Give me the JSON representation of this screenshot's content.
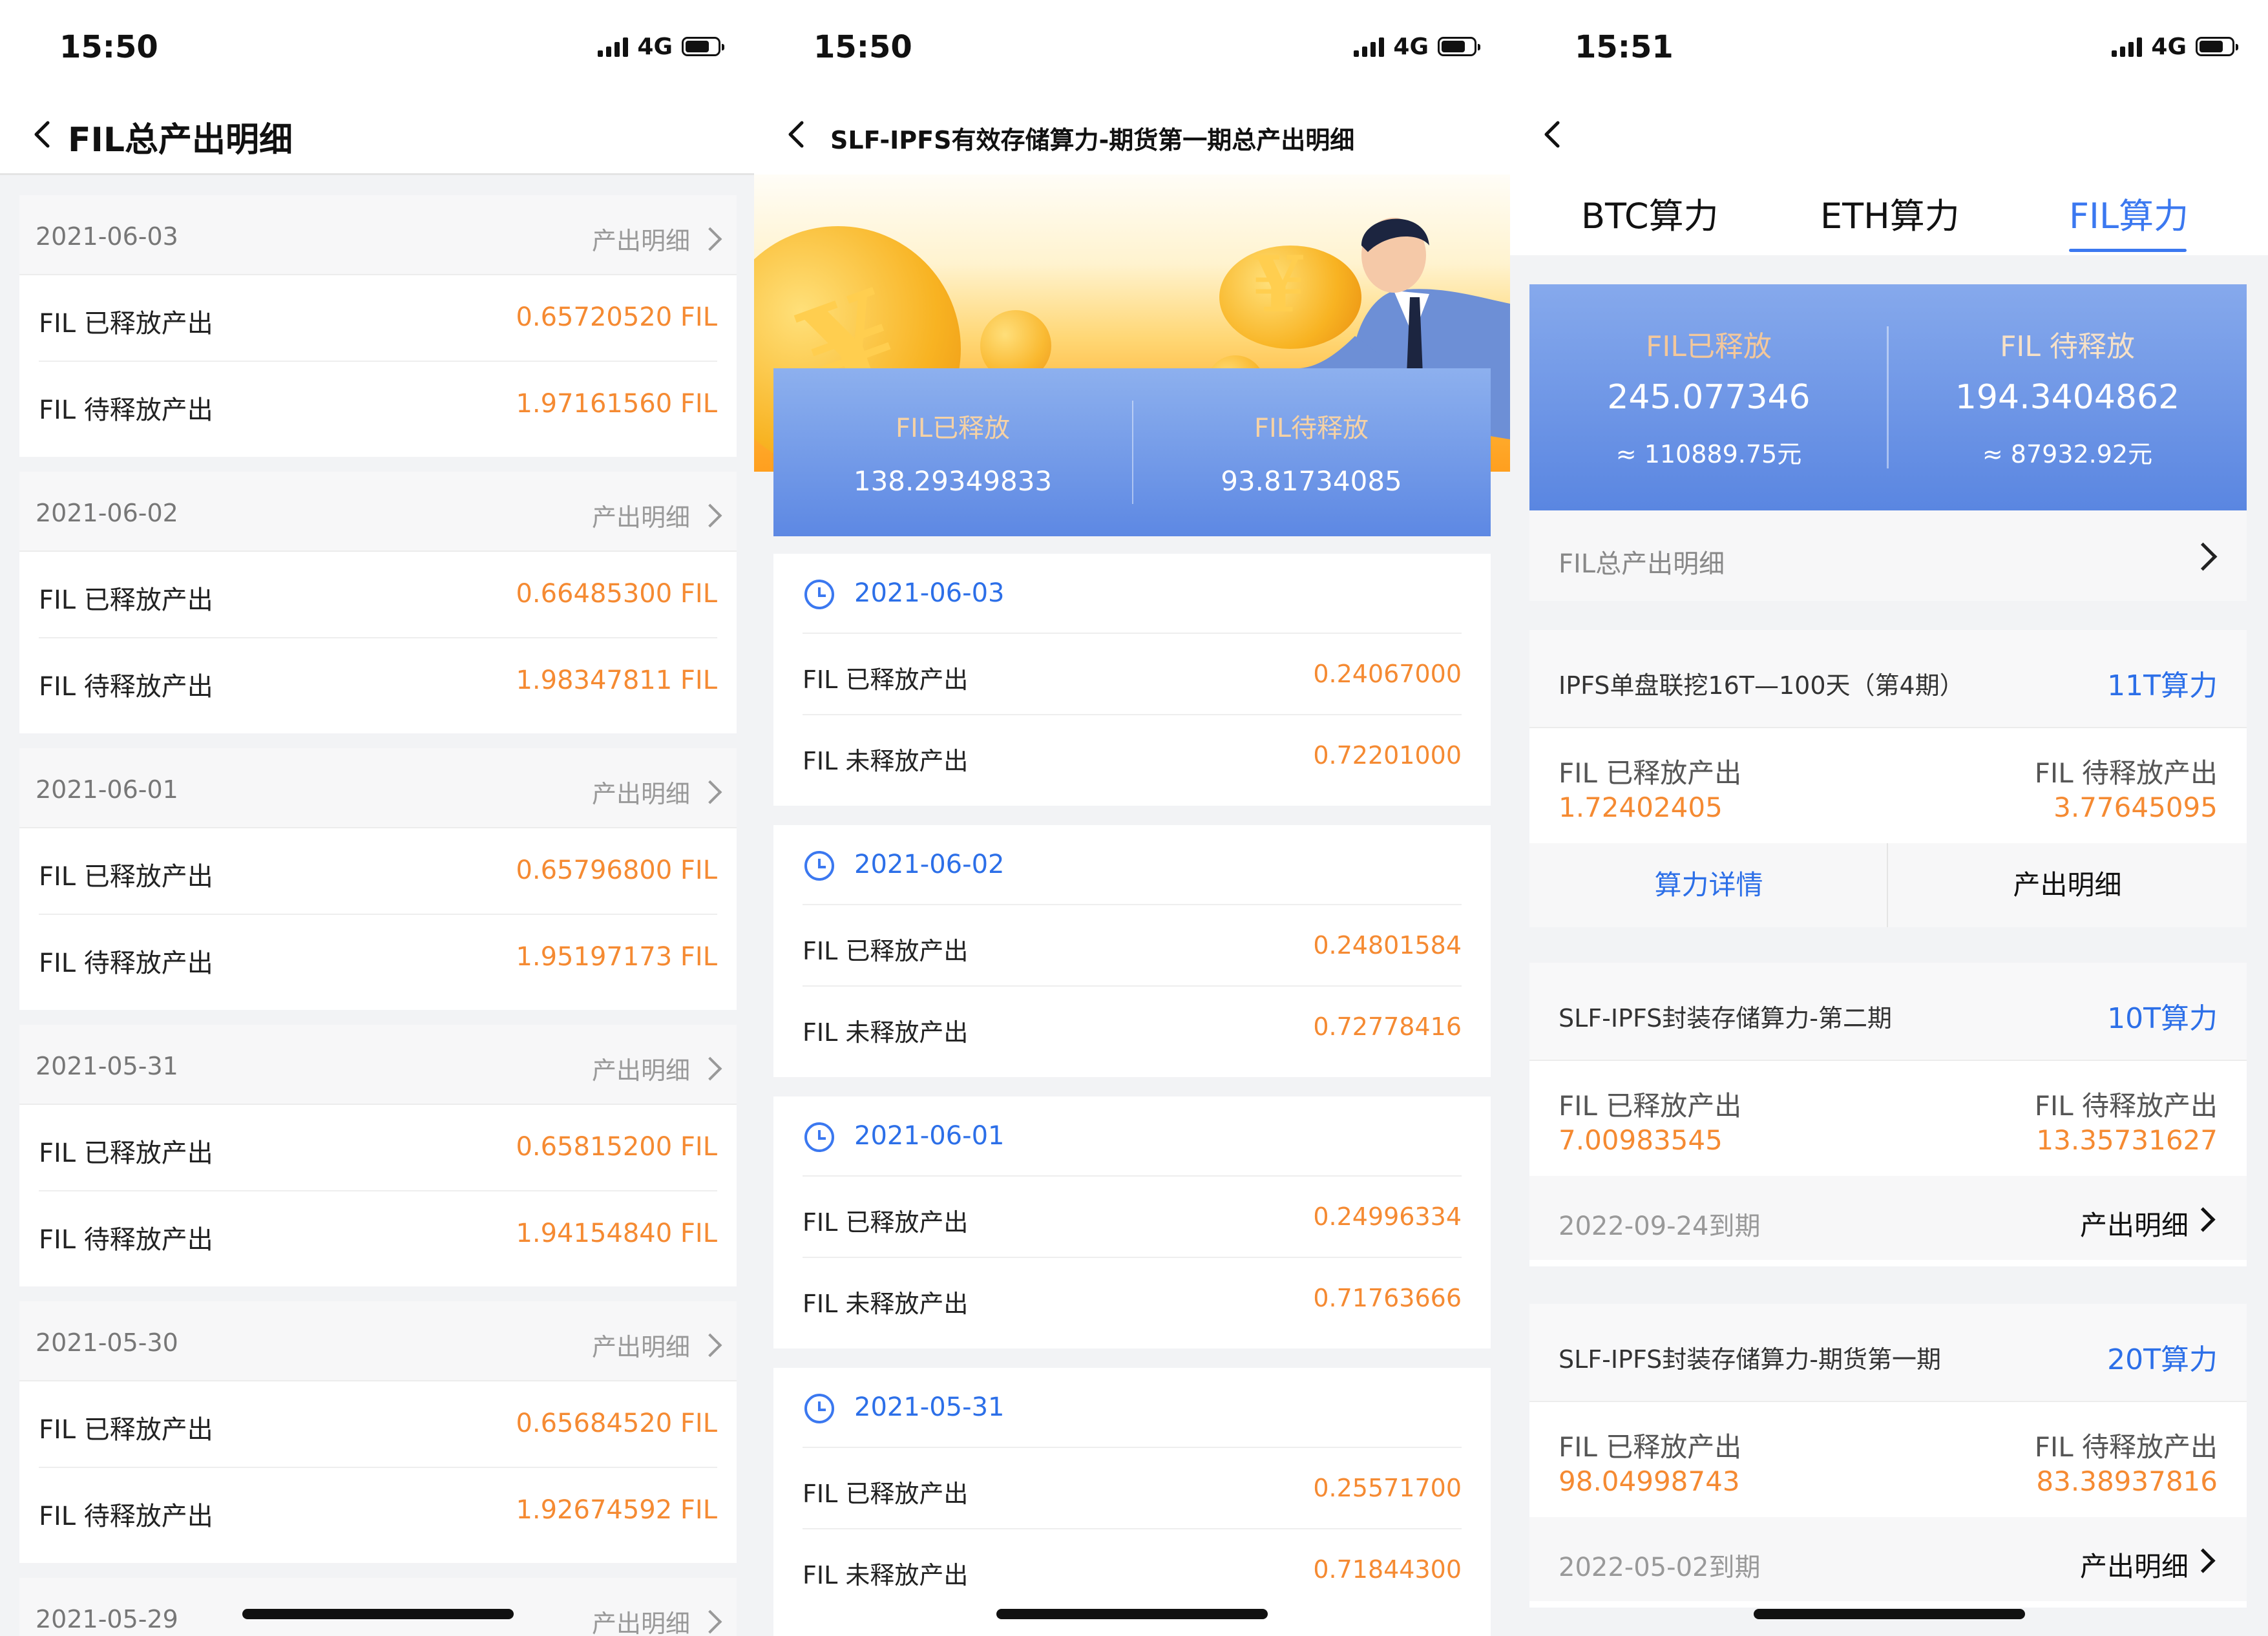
{
  "screens": [
    {
      "time": "15:50",
      "network": "4G",
      "title": "FIL总产出明细",
      "days": [
        {
          "date": "2021-06-03",
          "link": "产出明细",
          "released_label": "FIL 已释放产出",
          "released": "0.65720520 FIL",
          "pending_label": "FIL 待释放产出",
          "pending": "1.97161560 FIL"
        },
        {
          "date": "2021-06-02",
          "link": "产出明细",
          "released_label": "FIL 已释放产出",
          "released": "0.66485300 FIL",
          "pending_label": "FIL 待释放产出",
          "pending": "1.98347811 FIL"
        },
        {
          "date": "2021-06-01",
          "link": "产出明细",
          "released_label": "FIL 已释放产出",
          "released": "0.65796800 FIL",
          "pending_label": "FIL 待释放产出",
          "pending": "1.95197173 FIL"
        },
        {
          "date": "2021-05-31",
          "link": "产出明细",
          "released_label": "FIL 已释放产出",
          "released": "0.65815200 FIL",
          "pending_label": "FIL 待释放产出",
          "pending": "1.94154840 FIL"
        },
        {
          "date": "2021-05-30",
          "link": "产出明细",
          "released_label": "FIL 已释放产出",
          "released": "0.65684520 FIL",
          "pending_label": "FIL 待释放产出",
          "pending": "1.92674592 FIL"
        },
        {
          "date": "2021-05-29",
          "link": "产出明细"
        }
      ]
    },
    {
      "time": "15:50",
      "network": "4G",
      "title": "SLF-IPFS有效存储算力-期货第一期总产出明细",
      "summary": {
        "released_label": "FIL已释放",
        "released": "138.29349833",
        "pending_label": "FIL待释放",
        "pending": "93.81734085"
      },
      "days": [
        {
          "date": "2021-06-03",
          "released_label": "FIL 已释放产出",
          "released": "0.24067000",
          "pending_label": "FIL 未释放产出",
          "pending": "0.72201000"
        },
        {
          "date": "2021-06-02",
          "released_label": "FIL 已释放产出",
          "released": "0.24801584",
          "pending_label": "FIL 未释放产出",
          "pending": "0.72778416"
        },
        {
          "date": "2021-06-01",
          "released_label": "FIL 已释放产出",
          "released": "0.24996334",
          "pending_label": "FIL 未释放产出",
          "pending": "0.71763666"
        },
        {
          "date": "2021-05-31",
          "released_label": "FIL 已释放产出",
          "released": "0.25571700",
          "pending_label": "FIL 未释放产出",
          "pending": "0.71844300"
        }
      ]
    },
    {
      "time": "15:51",
      "network": "4G",
      "tabs": [
        "BTC算力",
        "ETH算力",
        "FIL算力"
      ],
      "active_tab": "FIL算力",
      "summary": {
        "released_label": "FIL已释放",
        "released": "245.077346",
        "released_cny": "≈ 110889.75元",
        "pending_label": "FIL 待释放",
        "pending": "194.3404862",
        "pending_cny": "≈ 87932.92元"
      },
      "total_link": "FIL总产出明细",
      "products": [
        {
          "name": "IPFS单盘联挖16T—100天（第4期）",
          "power": "11T算力",
          "released_label": "FIL 已释放产出",
          "released": "1.72402405",
          "pending_label": "FIL 待释放产出",
          "pending": "3.77645095",
          "btn_left": "算力详情",
          "btn_right": "产出明细"
        },
        {
          "name": "SLF-IPFS封装存储算力-第二期",
          "power": "10T算力",
          "released_label": "FIL 已释放产出",
          "released": "7.00983545",
          "pending_label": "FIL 待释放产出",
          "pending": "13.35731627",
          "expire": "2022-09-24到期",
          "detail": "产出明细"
        },
        {
          "name": "SLF-IPFS封装存储算力-期货第一期",
          "power": "20T算力",
          "released_label": "FIL 已释放产出",
          "released": "98.04998743",
          "pending_label": "FIL 待释放产出",
          "pending": "83.38937816",
          "expire": "2022-05-02到期",
          "detail": "产出明细"
        }
      ]
    }
  ],
  "colors": {
    "accent": "#2c6fe8",
    "value": "#f58a32",
    "summary_top": "#8db0ee",
    "summary_bottom": "#5d88e3"
  }
}
